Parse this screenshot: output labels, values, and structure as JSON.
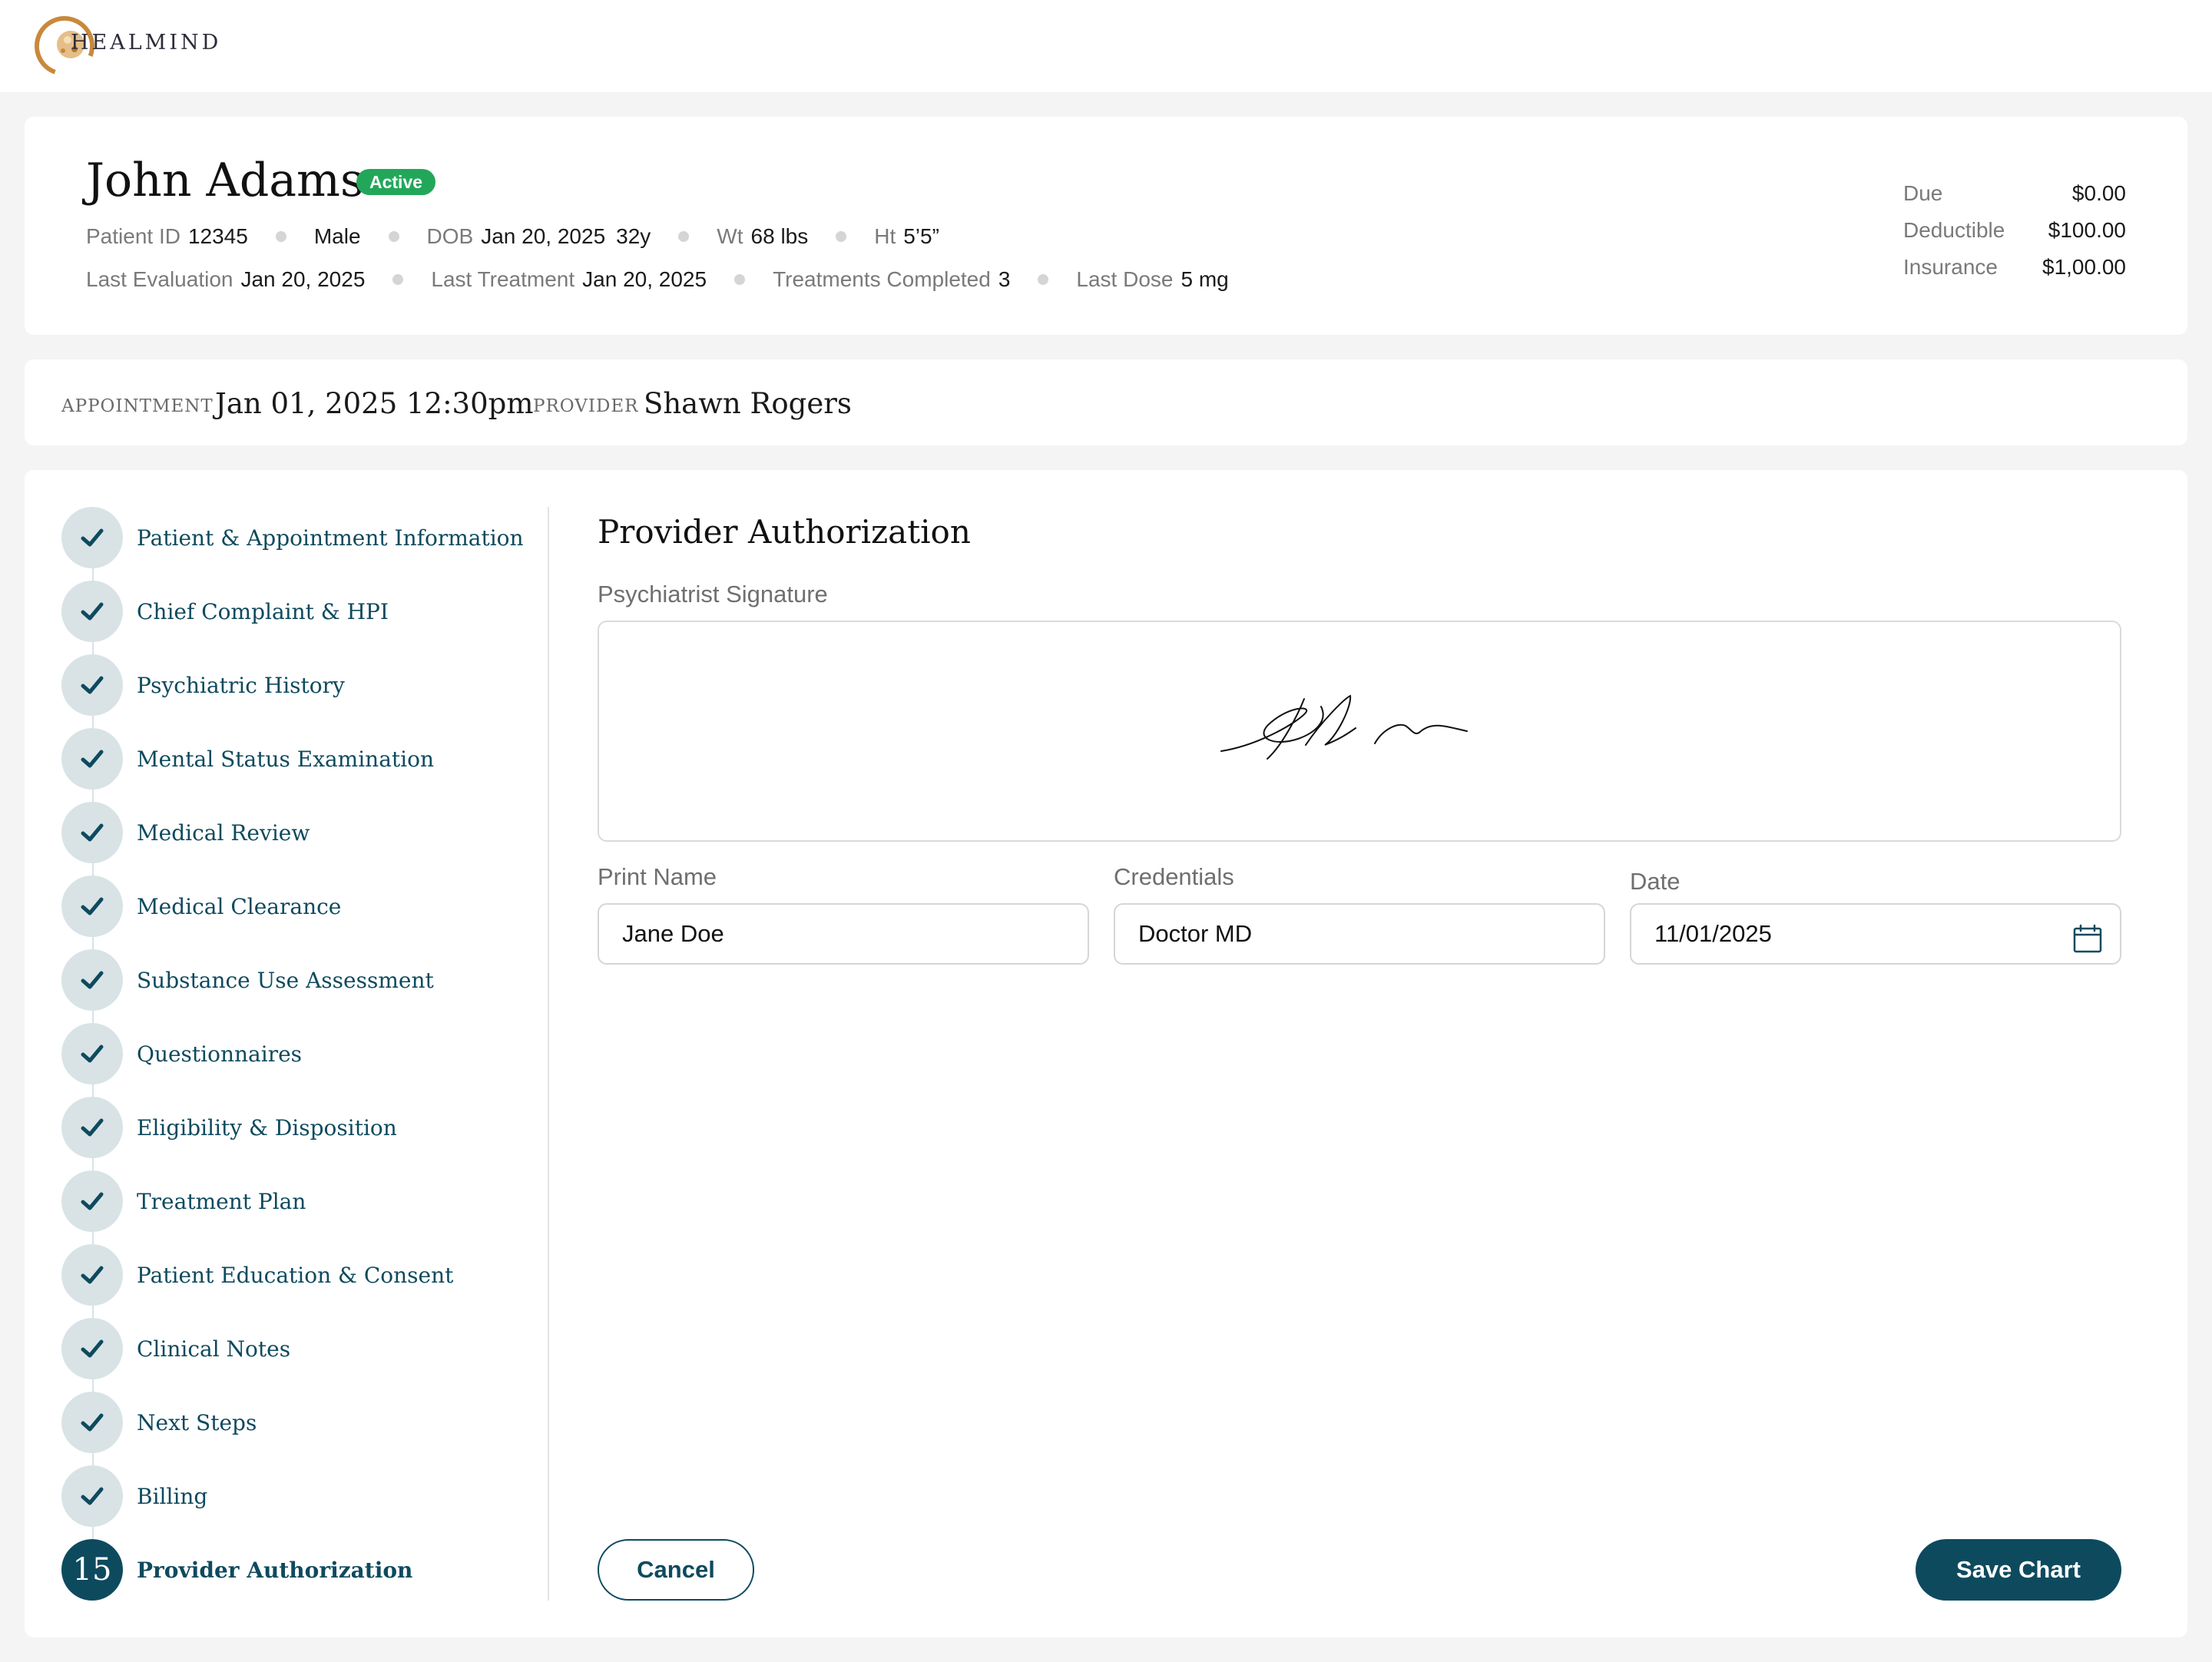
{
  "brand": {
    "name": "HEALMIND"
  },
  "patient": {
    "name": "John Adams",
    "status": "Active",
    "id_label": "Patient ID",
    "id": "12345",
    "sex": "Male",
    "dob_label": "DOB",
    "dob": "Jan 20, 2025",
    "age": "32y",
    "wt_label": "Wt",
    "wt": "68 lbs",
    "ht_label": "Ht",
    "ht": "5’5”",
    "last_eval_label": "Last Evaluation",
    "last_eval": "Jan 20, 2025",
    "last_treat_label": "Last Treatment",
    "last_treat": "Jan 20, 2025",
    "treat_completed_label": "Treatments Completed",
    "treat_completed": "3",
    "last_dose_label": "Last Dose",
    "last_dose": "5 mg"
  },
  "billing": {
    "due_label": "Due",
    "due": "$0.00",
    "deductible_label": "Deductible",
    "deductible": "$100.00",
    "insurance_label": "Insurance",
    "insurance": "$1,00.00"
  },
  "appointment": {
    "label": "APPOINTMENT",
    "value": "Jan 01, 2025 12:30pm",
    "provider_label": "PROVIDER",
    "provider": "Shawn Rogers"
  },
  "steps": [
    {
      "label": "Patient & Appointment Information"
    },
    {
      "label": "Chief Complaint & HPI"
    },
    {
      "label": "Psychiatric History"
    },
    {
      "label": "Mental Status Examination"
    },
    {
      "label": "Medical Review"
    },
    {
      "label": "Medical Clearance"
    },
    {
      "label": "Substance Use Assessment"
    },
    {
      "label": "Questionnaires"
    },
    {
      "label": "Eligibility & Disposition"
    },
    {
      "label": "Treatment Plan"
    },
    {
      "label": "Patient Education & Consent"
    },
    {
      "label": "Clinical Notes"
    },
    {
      "label": "Next Steps"
    },
    {
      "label": "Billing"
    },
    {
      "label": "Provider Authorization",
      "number": "15"
    }
  ],
  "form": {
    "title": "Provider Authorization",
    "signature_label": "Psychiatrist Signature",
    "print_name_label": "Print Name",
    "print_name": "Jane Doe",
    "credentials_label": "Credentials",
    "credentials": "Doctor MD",
    "date_label": "Date",
    "date": "11/01/2025"
  },
  "actions": {
    "cancel": "Cancel",
    "save": "Save Chart"
  },
  "colors": {
    "primary": "#0e4a5e",
    "status_active": "#22a75a",
    "step_done_bg": "#d9e3e6"
  },
  "icons": {
    "step_done": "check-icon",
    "date": "calendar-icon",
    "logo": "healmind-logo-icon"
  }
}
